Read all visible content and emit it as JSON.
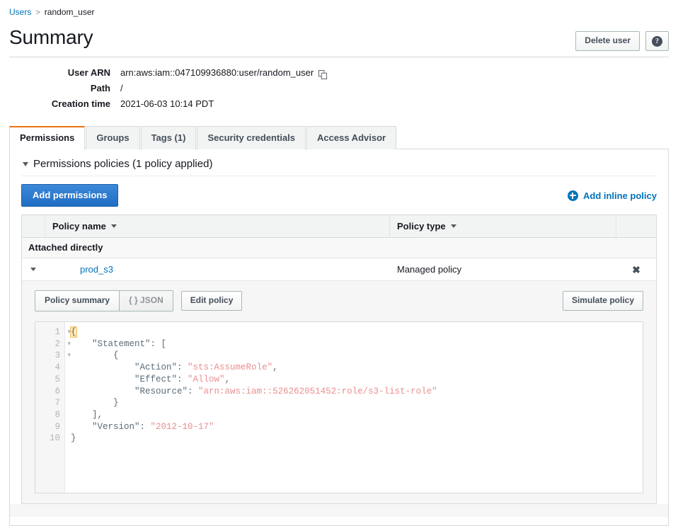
{
  "breadcrumb": {
    "root": "Users",
    "separator": ">",
    "current": "random_user"
  },
  "header": {
    "title": "Summary",
    "delete_button": "Delete user",
    "help_icon": "help-icon",
    "help_glyph": "?"
  },
  "details": [
    {
      "label": "User ARN",
      "value": "arn:aws:iam::047109936880:user/random_user",
      "has_copy": true
    },
    {
      "label": "Path",
      "value": "/",
      "has_copy": false
    },
    {
      "label": "Creation time",
      "value": "2021-06-03 10:14 PDT",
      "has_copy": false
    }
  ],
  "tabs": [
    {
      "label": "Permissions",
      "active": true
    },
    {
      "label": "Groups",
      "active": false
    },
    {
      "label": "Tags (1)",
      "active": false
    },
    {
      "label": "Security credentials",
      "active": false
    },
    {
      "label": "Access Advisor",
      "active": false
    }
  ],
  "permissions_section": {
    "heading": "Permissions policies (1 policy applied)",
    "add_permissions_button": "Add permissions",
    "add_inline_policy_link": "Add inline policy"
  },
  "policy_table": {
    "columns": {
      "policy_name": "Policy name",
      "policy_type": "Policy type"
    },
    "group_label": "Attached directly",
    "rows": [
      {
        "name": "prod_s3",
        "type": "Managed policy",
        "remove_glyph": "✖",
        "expanded": true
      }
    ]
  },
  "policy_detail": {
    "segmented": [
      {
        "label": "Policy summary",
        "selected": false
      },
      {
        "label": "{ } JSON",
        "selected": true
      }
    ],
    "edit_button": "Edit policy",
    "simulate_button": "Simulate policy",
    "editor": {
      "lines": [
        {
          "n": "1",
          "fold": true,
          "text": "{"
        },
        {
          "n": "2",
          "fold": true,
          "text": "    \"Statement\": ["
        },
        {
          "n": "3",
          "fold": true,
          "text": "        {"
        },
        {
          "n": "4",
          "fold": false,
          "text": "            \"Action\": \"sts:AssumeRole\","
        },
        {
          "n": "5",
          "fold": false,
          "text": "            \"Effect\": \"Allow\","
        },
        {
          "n": "6",
          "fold": false,
          "text": "            \"Resource\": \"arn:aws:iam::526262051452:role/s3-list-role\""
        },
        {
          "n": "7",
          "fold": false,
          "text": "        }"
        },
        {
          "n": "8",
          "fold": false,
          "text": "    ],"
        },
        {
          "n": "9",
          "fold": false,
          "text": "    \"Version\": \"2012-10-17\""
        },
        {
          "n": "10",
          "fold": false,
          "text": "}"
        }
      ],
      "document": {
        "Statement": [
          {
            "Action": "sts:AssumeRole",
            "Effect": "Allow",
            "Resource": "arn:aws:iam::526262051452:role/s3-list-role"
          }
        ],
        "Version": "2012-10-17"
      }
    }
  },
  "colors": {
    "accent_orange": "#ec7211",
    "link_blue": "#0073bb",
    "primary_button": "#1f6dc4",
    "string_token": "#e8908f",
    "code_text": "#5a6b78"
  }
}
